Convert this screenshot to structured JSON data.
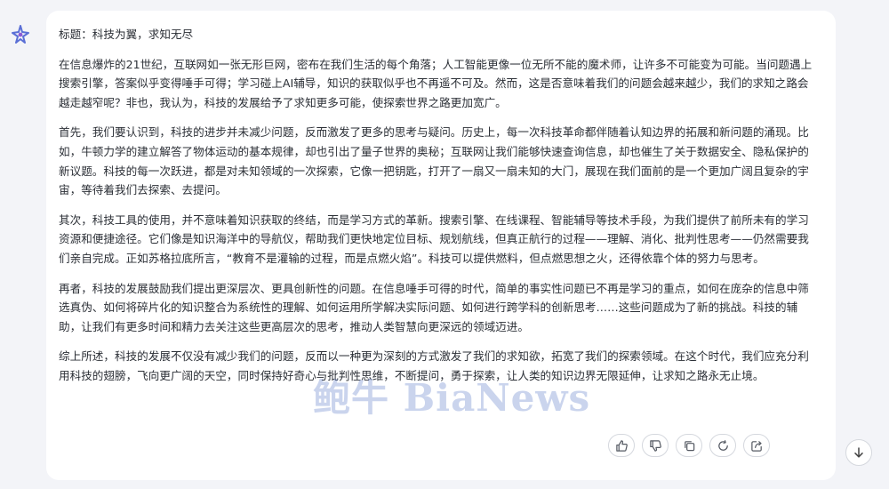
{
  "colors": {
    "page_bg": "#f3f4f8",
    "card_bg": "#ffffff",
    "text": "#2b2f36",
    "icon": "#555a63",
    "accent": "#5a6fd6"
  },
  "assistant": {
    "avatar_icon": "ai-logo-icon"
  },
  "message": {
    "title": "标题：科技为翼，求知无尽",
    "paragraphs": [
      "在信息爆炸的21世纪，互联网如一张无形巨网，密布在我们生活的每个角落；人工智能更像一位无所不能的魔术师，让许多不可能变为可能。当问题遇上搜索引擎，答案似乎变得唾手可得；学习碰上AI辅导，知识的获取似乎也不再遥不可及。然而，这是否意味着我们的问题会越来越少，我们的求知之路会越走越窄呢？非也，我认为，科技的发展给予了求知更多可能，使探索世界之路更加宽广。",
      "首先，我们要认识到，科技的进步并未减少问题，反而激发了更多的思考与疑问。历史上，每一次科技革命都伴随着认知边界的拓展和新问题的涌现。比如，牛顿力学的建立解答了物体运动的基本规律，却也引出了量子世界的奥秘；互联网让我们能够快速查询信息，却也催生了关于数据安全、隐私保护的新议题。科技的每一次跃进，都是对未知领域的一次探索，它像一把钥匙，打开了一扇又一扇未知的大门，展现在我们面前的是一个更加广阔且复杂的宇宙，等待着我们去探索、去提问。",
      "其次，科技工具的使用，并不意味着知识获取的终结，而是学习方式的革新。搜索引擎、在线课程、智能辅导等技术手段，为我们提供了前所未有的学习资源和便捷途径。它们像是知识海洋中的导航仪，帮助我们更快地定位目标、规划航线，但真正航行的过程——理解、消化、批判性思考——仍然需要我们亲自完成。正如苏格拉底所言，“教育不是灌输的过程，而是点燃火焰”。科技可以提供燃料，但点燃思想之火，还得依靠个体的努力与思考。",
      "再者，科技的发展鼓励我们提出更深层次、更具创新性的问题。在信息唾手可得的时代，简单的事实性问题已不再是学习的重点，如何在庞杂的信息中筛选真伪、如何将碎片化的知识整合为系统性的理解、如何运用所学解决实际问题、如何进行跨学科的创新思考……这些问题成为了新的挑战。科技的辅助，让我们有更多时间和精力去关注这些更高层次的思考，推动人类智慧向更深远的领域迈进。",
      "综上所述，科技的发展不仅没有减少我们的问题，反而以一种更为深刻的方式激发了我们的求知欲，拓宽了我们的探索领域。在这个时代，我们应充分利用科技的翅膀，飞向更广阔的天空，同时保持好奇心与批判性思维，不断提问，勇于探索，让人类的知识边界无限延伸，让求知之路永无止境。"
    ]
  },
  "watermark": "鲍牛 BiaNews",
  "actions": [
    {
      "icon": "thumbs-up-icon"
    },
    {
      "icon": "thumbs-down-icon"
    },
    {
      "icon": "copy-icon"
    },
    {
      "icon": "regenerate-icon"
    },
    {
      "icon": "share-icon"
    }
  ],
  "scroll": {
    "icon": "arrow-down-icon"
  }
}
